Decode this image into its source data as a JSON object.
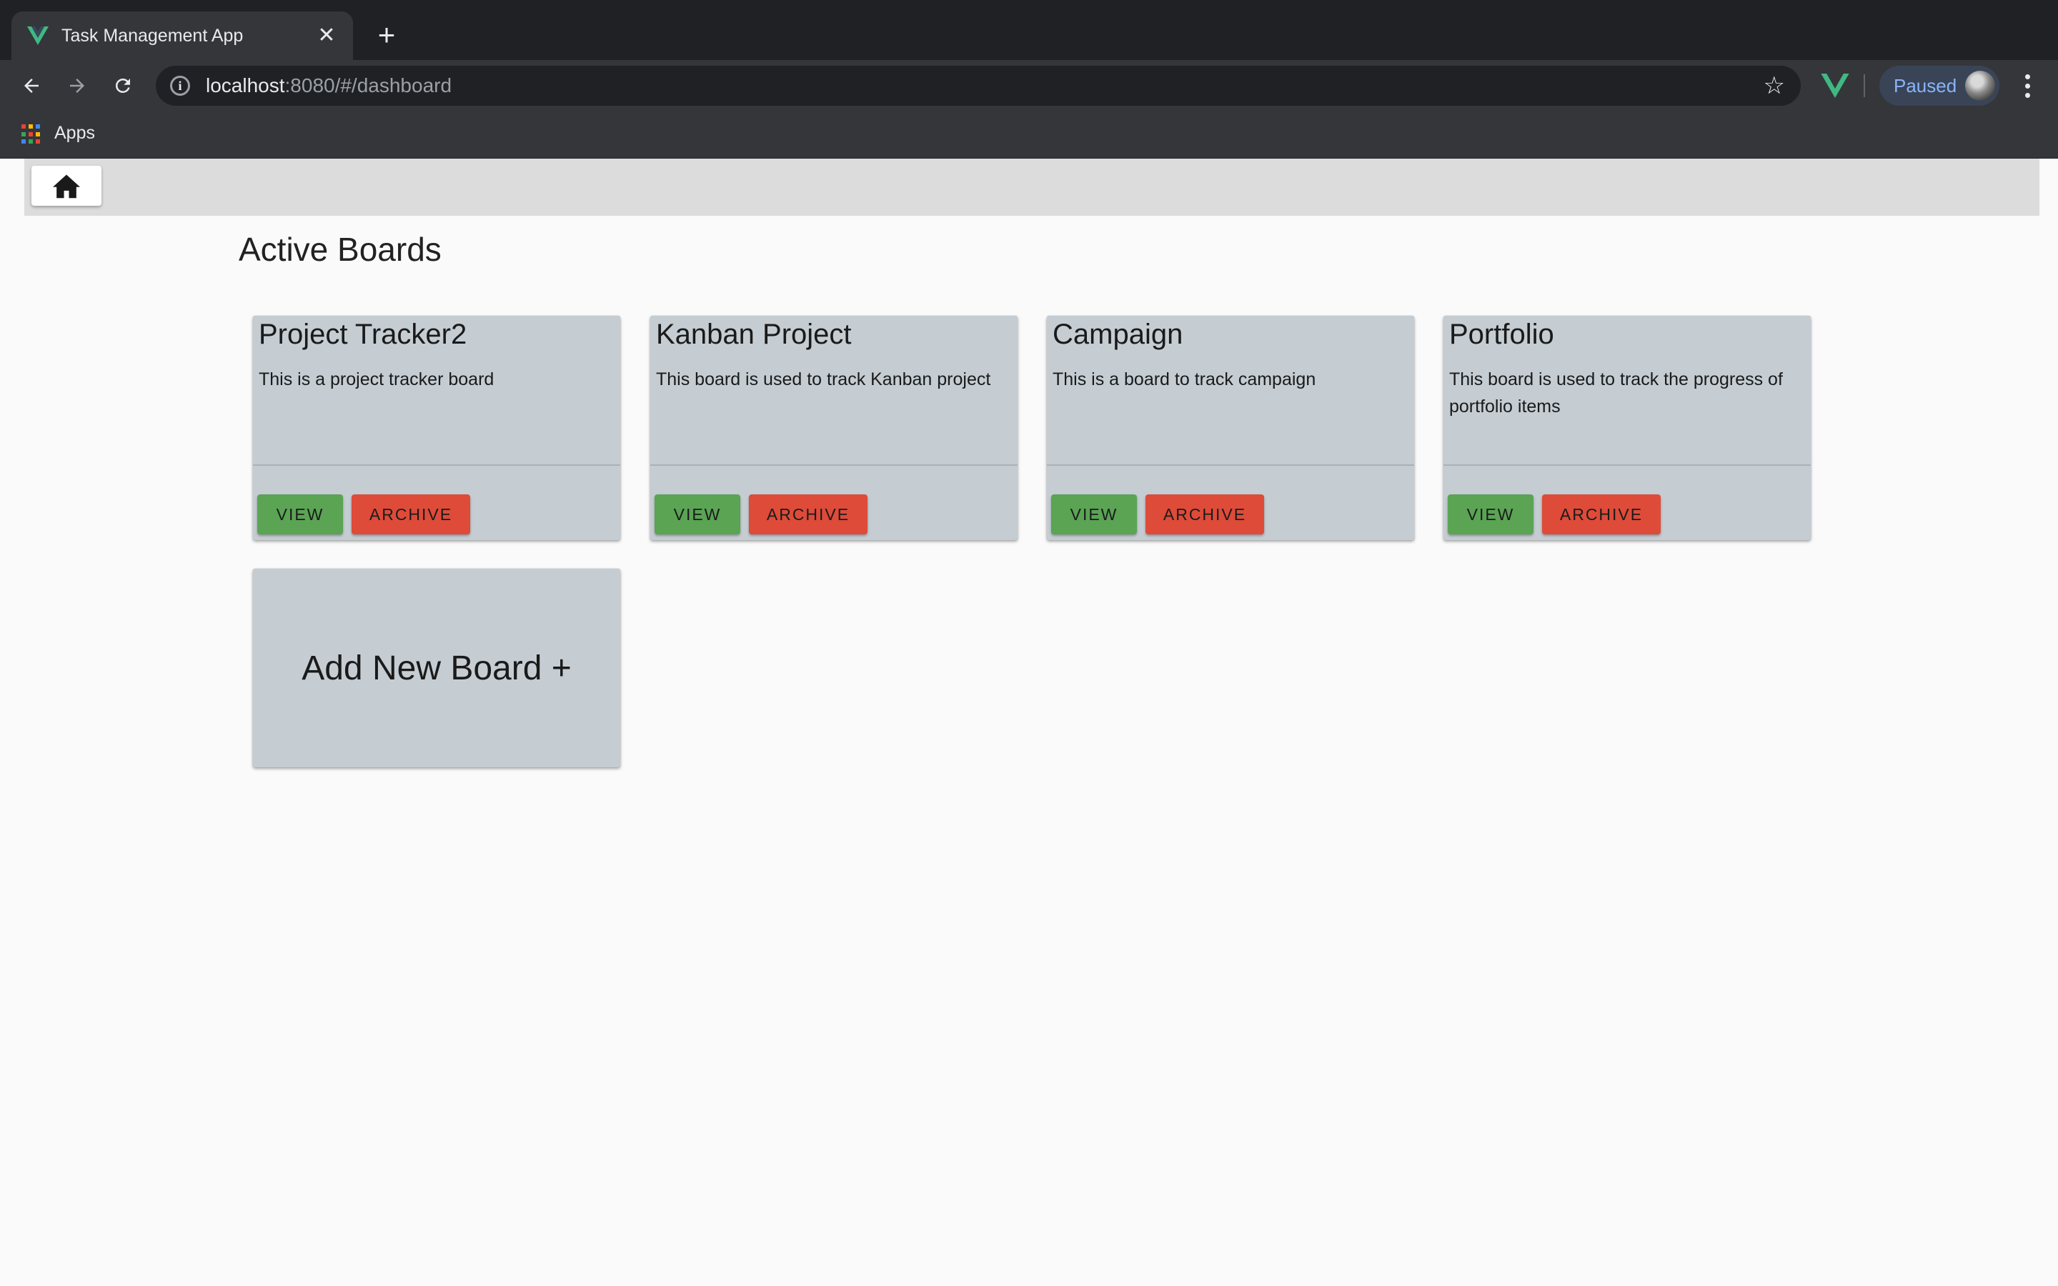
{
  "browser": {
    "tab_title": "Task Management App",
    "url_host": "localhost",
    "url_rest": ":8080/#/dashboard",
    "profile_status": "Paused",
    "bookmarks": {
      "apps_label": "Apps"
    }
  },
  "app": {
    "page_title": "Active Boards",
    "boards": [
      {
        "name": "Project Tracker2",
        "description": "This is a project tracker board",
        "view_label": "VIEW",
        "archive_label": "ARCHIVE"
      },
      {
        "name": "Kanban Project",
        "description": "This board is used to track Kanban project",
        "view_label": "VIEW",
        "archive_label": "ARCHIVE"
      },
      {
        "name": "Campaign",
        "description": "This is a board to track campaign",
        "view_label": "VIEW",
        "archive_label": "ARCHIVE"
      },
      {
        "name": "Portfolio",
        "description": "This board is used to track the progress of portfolio items",
        "view_label": "VIEW",
        "archive_label": "ARCHIVE"
      }
    ],
    "add_board_label": "Add New Board +"
  },
  "icons": {
    "tab_favicon": "vue-logo-icon",
    "home": "home-icon",
    "extension": "vue-devtools-icon"
  },
  "colors": {
    "view_button": "#5aa454",
    "archive_button": "#de4b39",
    "card_background": "#c5cdd3",
    "nav_background": "#dcdcdc"
  }
}
